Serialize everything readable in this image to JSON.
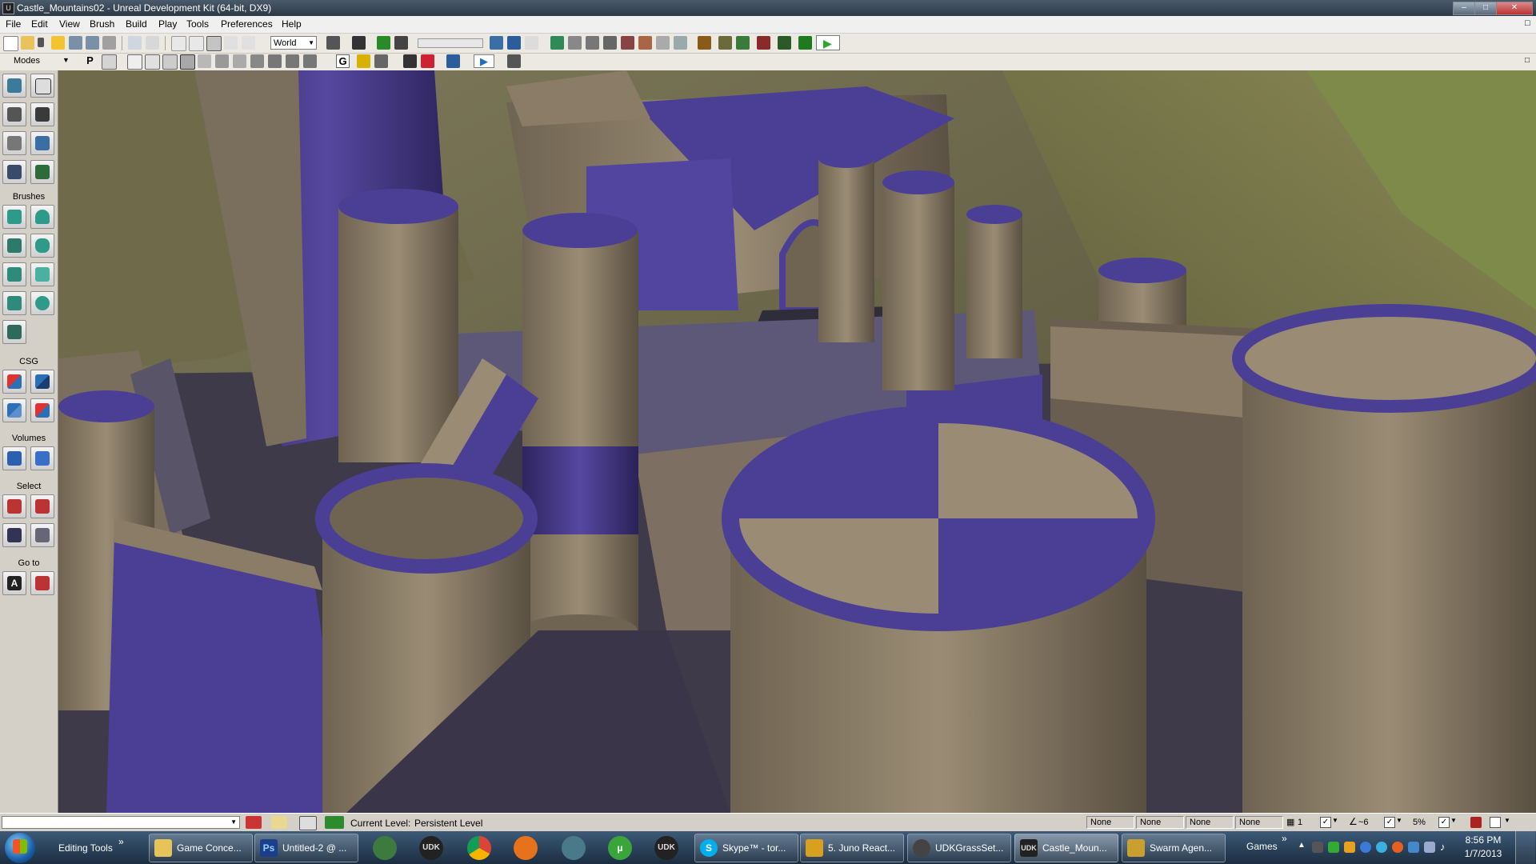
{
  "window": {
    "title": "Castle_Mountains02 - Unreal Development Kit (64-bit, DX9)"
  },
  "menu": [
    "File",
    "Edit",
    "View",
    "Brush",
    "Build",
    "Play",
    "Tools",
    "Preferences",
    "Help"
  ],
  "toolbar": {
    "coord_system": "World"
  },
  "modes_panel": {
    "title": "Modes",
    "sections": {
      "brushes": "Brushes",
      "csg": "CSG",
      "volumes": "Volumes",
      "select": "Select",
      "goto": "Go to"
    }
  },
  "toolbar2": {
    "letters": [
      "P",
      "G"
    ]
  },
  "statusbar": {
    "current_level_label": "Current Level:",
    "current_level_value": "Persistent Level",
    "fields": [
      "None",
      "None",
      "None",
      "None"
    ],
    "grid_value": "1",
    "rotation_value": "~6",
    "scale_value": "5%"
  },
  "taskbar": {
    "editing_tools": "Editing Tools",
    "tasks": [
      "Game Conce...",
      "Untitled-2 @ ...",
      "Skype™ - tor...",
      "5. Juno React...",
      "UDKGrassSet...",
      "Castle_Moun...",
      "Swarm Agen..."
    ],
    "games": "Games",
    "clock_time": "8:56 PM",
    "clock_date": "1/7/2013",
    "pinned_labels": [
      "UDK",
      "UDK"
    ]
  },
  "colors": {
    "accent_purple": "#4a3d8c",
    "stone": "#8a7c66",
    "sky_terrain": "#6b6a48"
  }
}
